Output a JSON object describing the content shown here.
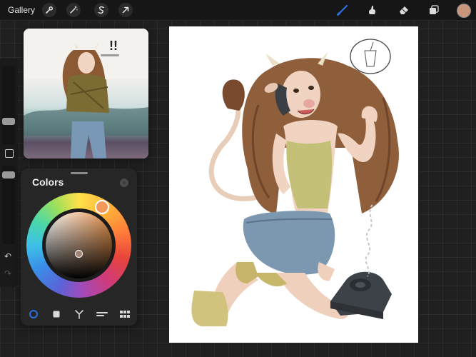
{
  "topbar": {
    "gallery_label": "Gallery",
    "actions_icon": "wrench-icon",
    "adjustments_icon": "magic-wand-icon",
    "selection_icon": "selection-s-icon",
    "transform_icon": "arrow-cursor-icon",
    "brush_icon": "brush-icon",
    "smudge_icon": "smudge-icon",
    "eraser_icon": "eraser-icon",
    "layers_icon": "layers-icon",
    "active_tool": "brush",
    "current_color": "#c8977a",
    "accent_color": "#2f6fe0"
  },
  "colors_panel": {
    "title": "Colors",
    "active_mode": "disc",
    "modes": [
      "disc",
      "classic",
      "harmony",
      "value",
      "palettes"
    ]
  }
}
